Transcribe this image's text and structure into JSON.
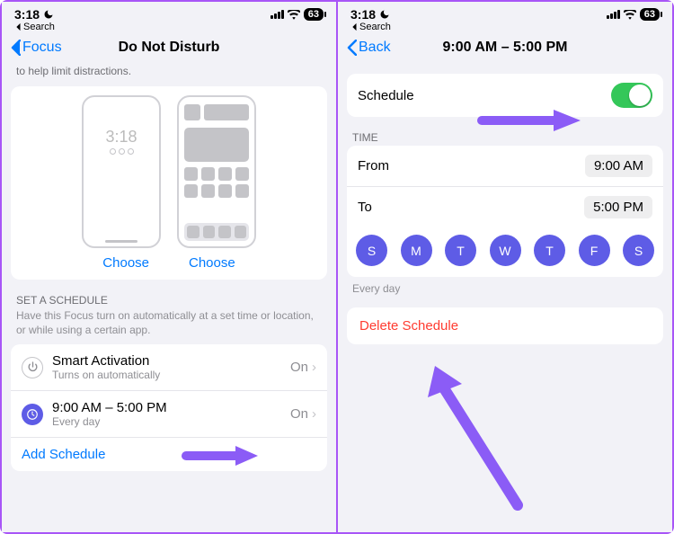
{
  "status": {
    "time": "3:18",
    "battery": "63",
    "search_crumb": "Search"
  },
  "left": {
    "back_label": "Focus",
    "title": "Do Not Disturb",
    "truncated_hint": "to help limit distractions.",
    "mock_time": "3:18",
    "choose_label": "Choose",
    "schedule_header": "SET A SCHEDULE",
    "schedule_hint": "Have this Focus turn on automatically at a set time or location, or while using a certain app.",
    "smart": {
      "title": "Smart Activation",
      "sub": "Turns on automatically",
      "state": "On"
    },
    "timed": {
      "title": "9:00 AM – 5:00 PM",
      "sub": "Every day",
      "state": "On"
    },
    "add_label": "Add Schedule"
  },
  "right": {
    "back_label": "Back",
    "title": "9:00 AM – 5:00 PM",
    "schedule_label": "Schedule",
    "time_header": "TIME",
    "from_label": "From",
    "from_value": "9:00 AM",
    "to_label": "To",
    "to_value": "5:00 PM",
    "days": [
      "S",
      "M",
      "T",
      "W",
      "T",
      "F",
      "S"
    ],
    "days_hint": "Every day",
    "delete_label": "Delete Schedule"
  },
  "annotation": {
    "arrow_color": "#8b5cf6"
  }
}
